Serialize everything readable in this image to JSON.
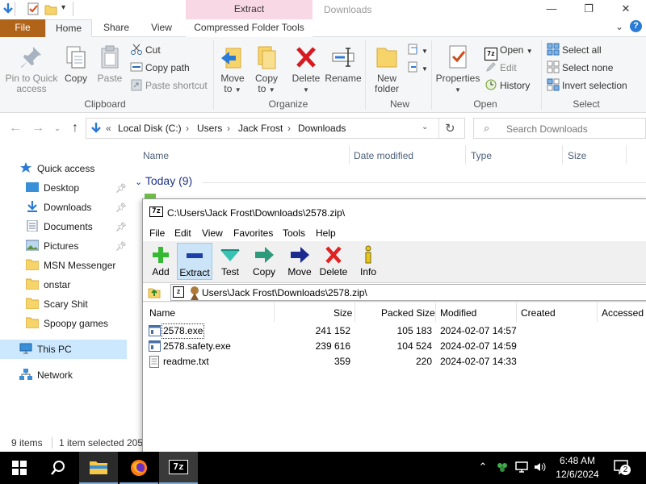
{
  "window": {
    "contextual_tab_top": "Extract",
    "title": "Downloads",
    "minimize": "—",
    "maximize": "❐",
    "close": "✕"
  },
  "ribbon_tabs": [
    "File",
    "Home",
    "Share",
    "View",
    "Compressed Folder Tools"
  ],
  "ribbon": {
    "clipboard": {
      "pin_to_quick_access_line1": "Pin to Quick",
      "pin_to_quick_access_line2": "access",
      "copy": "Copy",
      "paste": "Paste",
      "cut": "Cut",
      "copy_path": "Copy path",
      "paste_shortcut": "Paste shortcut",
      "group_label": "Clipboard"
    },
    "organize": {
      "move_to_line1": "Move",
      "move_to_line2": "to",
      "copy_to_line1": "Copy",
      "copy_to_line2": "to",
      "delete": "Delete",
      "rename": "Rename",
      "group_label": "Organize"
    },
    "new": {
      "new_folder_line1": "New",
      "new_folder_line2": "folder",
      "group_label": "New"
    },
    "open": {
      "properties": "Properties",
      "open": "Open",
      "edit": "Edit",
      "history": "History",
      "group_label": "Open"
    },
    "select": {
      "select_all": "Select all",
      "select_none": "Select none",
      "invert_selection": "Invert selection",
      "group_label": "Select"
    }
  },
  "address": {
    "overflow": "«",
    "segments": [
      "Local Disk (C:)",
      "Users",
      "Jack Frost",
      "Downloads"
    ],
    "search_placeholder": "Search Downloads"
  },
  "nav_pane": {
    "quick_access": "Quick access",
    "items": [
      "Desktop",
      "Downloads",
      "Documents",
      "Pictures",
      "MSN Messenger",
      "onstar",
      "Scary Shit",
      "Spoopy games"
    ],
    "this_pc": "This PC",
    "network": "Network"
  },
  "file_list": {
    "columns": [
      "Name",
      "Date modified",
      "Type",
      "Size"
    ],
    "group_header": "Today (9)"
  },
  "status_bar": {
    "item_count": "9 items",
    "selected": "1 item selected",
    "size_partial": "205"
  },
  "sevenzip": {
    "logo": "7z",
    "title": "C:\\Users\\Jack Frost\\Downloads\\2578.zip\\",
    "menu": [
      "File",
      "Edit",
      "View",
      "Favorites",
      "Tools",
      "Help"
    ],
    "toolbar": [
      "Add",
      "Extract",
      "Test",
      "Copy",
      "Move",
      "Delete",
      "Info"
    ],
    "path": "Users\\Jack Frost\\Downloads\\2578.zip\\",
    "columns": [
      "Name",
      "Size",
      "Packed Size",
      "Modified",
      "Created",
      "Accessed"
    ],
    "rows": [
      {
        "name": "2578.exe",
        "size": "241 152",
        "packed": "105 183",
        "modified": "2024-02-07 14:57"
      },
      {
        "name": "2578.safety.exe",
        "size": "239 616",
        "packed": "104 524",
        "modified": "2024-02-07 14:59"
      },
      {
        "name": "readme.txt",
        "size": "359",
        "packed": "220",
        "modified": "2024-02-07 14:33"
      }
    ]
  },
  "taskbar": {
    "sevenzip_label": "7z",
    "time": "6:48 AM",
    "date": "12/6/2024",
    "notification_count": "2"
  }
}
